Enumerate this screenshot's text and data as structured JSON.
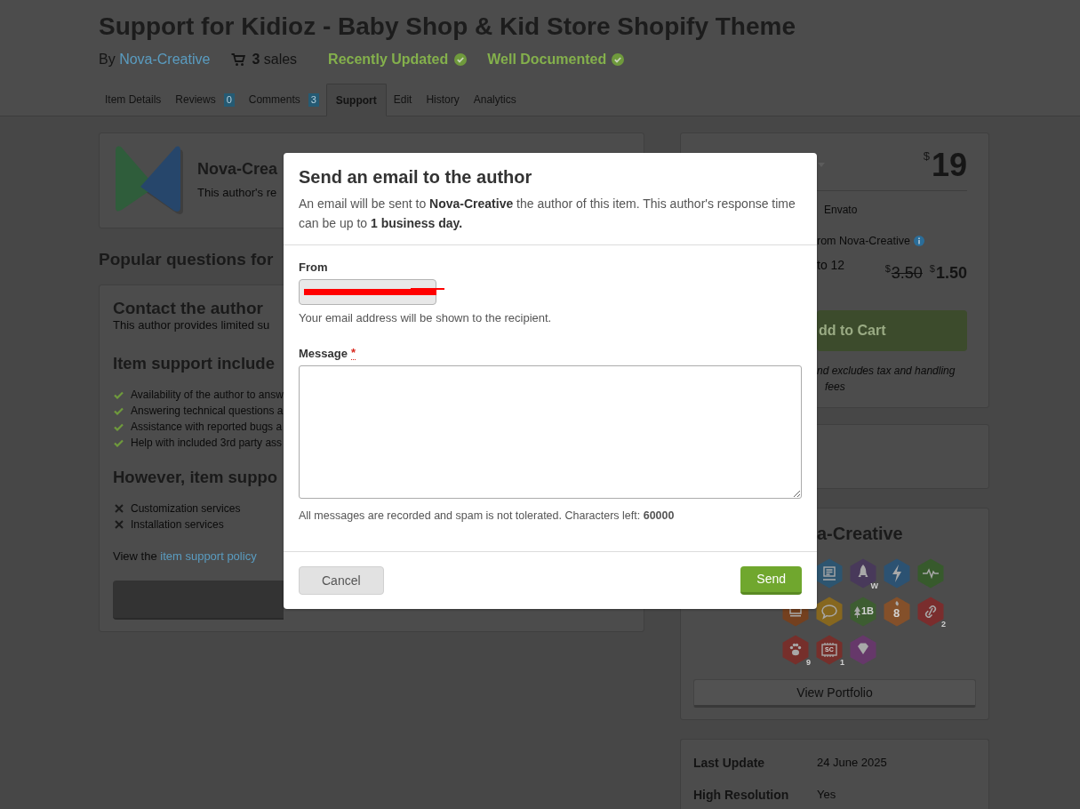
{
  "header": {
    "title": "Support for Kidioz - Baby Shop & Kid Store Shopify Theme",
    "byline": {
      "prefix": "By",
      "author": "Nova-Creative"
    },
    "sales": "**3** sales",
    "flags": [
      {
        "label": "Recently Updated"
      },
      {
        "label": "Well Documented"
      }
    ],
    "tabs": [
      {
        "label": "Item Details",
        "selected": false
      },
      {
        "label": "Reviews",
        "count": "0",
        "selected": false
      },
      {
        "label": "Comments",
        "count": "3",
        "selected": false
      },
      {
        "label": "Support",
        "selected": true
      },
      {
        "label": "Edit",
        "selected": false
      },
      {
        "label": "History",
        "selected": false
      },
      {
        "label": "Analytics",
        "selected": false
      }
    ]
  },
  "author_card": {
    "name": "Nova-Crea",
    "note": "This author's re"
  },
  "questions_heading": "Popular questions for",
  "support_card": {
    "title": "Contact the author",
    "subtitle": "This author provides limited su",
    "sections": [
      {
        "heading": "Item support include",
        "items": [
          {
            "kind": "included",
            "text": "Availability of the author to answ"
          },
          {
            "kind": "included",
            "text": "Answering technical questions a"
          },
          {
            "kind": "included",
            "text": "Assistance with reported bugs a"
          },
          {
            "kind": "included",
            "text": "Help with included 3rd party ass"
          }
        ]
      },
      {
        "heading": "However, item suppo",
        "items": [
          {
            "kind": "excluded",
            "text": "Customization services"
          },
          {
            "kind": "excluded",
            "text": "Installation services"
          }
        ]
      }
    ],
    "policy": {
      "text": "View the",
      "link": "item support policy"
    }
  },
  "purchase_card": {
    "price": {
      "currency": "$",
      "amount": "19"
    },
    "vendor_note": "Envato",
    "support_note": "rom Nova-Creative",
    "extension": {
      "label": "to 12",
      "old_price": {
        "currency": "$",
        "amount": "3.50"
      },
      "new_price": {
        "currency": "$",
        "amount": "1.50"
      }
    },
    "cart_button": "dd to Cart",
    "price_note": "nd excludes tax and handling fees"
  },
  "author_panel": {
    "name": "a-Creative",
    "badges": [
      {
        "kind": "document",
        "color": "#2d5570"
      },
      {
        "kind": "rocket",
        "color": "#48395a",
        "count": "W"
      },
      {
        "kind": "lightning",
        "color": "#2c5272"
      },
      {
        "kind": "pulse",
        "color": "#375a2c"
      },
      {
        "kind": "laptop",
        "color": "#74401f"
      },
      {
        "kind": "speech",
        "color": "#86671f"
      },
      {
        "kind": "tree",
        "color": "#3d5d31",
        "label": "1B"
      },
      {
        "kind": "flame",
        "color": "#84502a",
        "label": "8"
      },
      {
        "kind": "link",
        "color": "#7a2d2d",
        "count": "2"
      },
      {
        "kind": "paw",
        "color": "#762f2b",
        "count": "9"
      },
      {
        "kind": "chip",
        "color": "#762f2b",
        "label": "SC",
        "count": "1"
      },
      {
        "kind": "diamond",
        "color": "#66386a"
      }
    ],
    "portfolio_button": "View Portfolio"
  },
  "details": [
    {
      "label": "Last Update",
      "value": "24 June 2025"
    },
    {
      "label": "High Resolution",
      "value": "Yes"
    }
  ],
  "dialog": {
    "title": "Send an email to the author",
    "intro": "An email will be sent to **Nova-Creative** the author of this item. This author's response time can be up to **1 business day.**",
    "from": {
      "label": "From",
      "disabled": true,
      "redacted": true,
      "hint": "Your email address will be shown to the recipient."
    },
    "message": {
      "label": "Message",
      "required_mark": "*"
    },
    "footnote": "All messages are recorded and spam is not tolerated. Characters left: **60000**",
    "buttons": [
      {
        "label": "Cancel",
        "kind": "secondary"
      },
      {
        "label": "Send",
        "kind": "primary"
      }
    ]
  }
}
